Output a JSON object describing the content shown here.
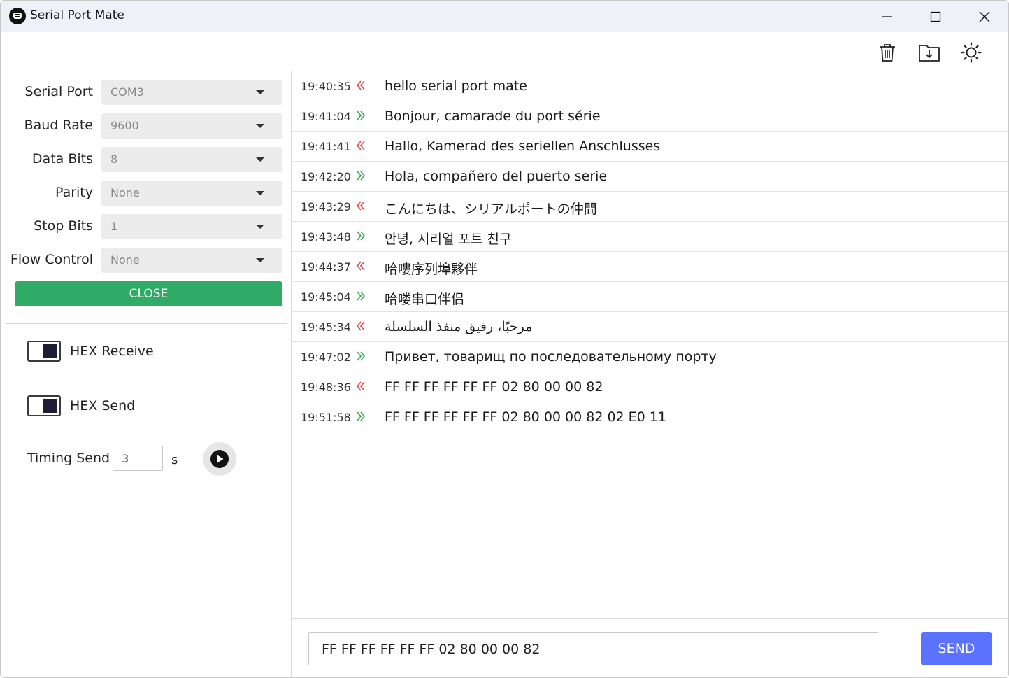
{
  "window": {
    "title": "Serial Port Mate",
    "icon": "chat-bubble-icon",
    "controls": [
      "minimize-icon",
      "maximize-icon",
      "close-icon"
    ]
  },
  "toolbar": {
    "icons": [
      "trash-icon",
      "download-folder-icon",
      "sun-theme-icon"
    ]
  },
  "config": {
    "serial_port": {
      "label": "Serial Port",
      "value": "COM3"
    },
    "baud_rate": {
      "label": "Baud Rate",
      "value": "9600"
    },
    "data_bits": {
      "label": "Data Bits",
      "value": "8"
    },
    "parity": {
      "label": "Parity",
      "value": "None"
    },
    "stop_bits": {
      "label": "Stop Bits",
      "value": "1"
    },
    "flow_control": {
      "label": "Flow Control",
      "value": "None"
    },
    "close_label": "CLOSE"
  },
  "options": {
    "hex_receive": {
      "label": "HEX Receive",
      "checked": true
    },
    "hex_send": {
      "label": "HEX Send",
      "checked": true
    },
    "timing_send": {
      "label": "Timing Send",
      "value": "3",
      "unit": "s"
    }
  },
  "log": [
    {
      "time": "19:40:35",
      "direction": "received",
      "text": "hello serial port mate"
    },
    {
      "time": "19:41:04",
      "direction": "sent",
      "text": "Bonjour, camarade du port série"
    },
    {
      "time": "19:41:41",
      "direction": "received",
      "text": "Hallo, Kamerad des seriellen Anschlusses"
    },
    {
      "time": "19:42:20",
      "direction": "sent",
      "text": "Hola, compañero del puerto serie"
    },
    {
      "time": "19:43:29",
      "direction": "received",
      "text": "こんにちは、シリアルポートの仲間"
    },
    {
      "time": "19:43:48",
      "direction": "sent",
      "text": "안녕, 시리얼 포트 친구"
    },
    {
      "time": "19:44:37",
      "direction": "received",
      "text": "哈嘍序列埠夥伴"
    },
    {
      "time": "19:45:04",
      "direction": "sent",
      "text": "哈喽串口伴侣"
    },
    {
      "time": "19:45:34",
      "direction": "received",
      "text": "مرحبًا، رفيق منفذ السلسلة"
    },
    {
      "time": "19:47:02",
      "direction": "sent",
      "text": "Привет, товарищ по последовательному порту"
    },
    {
      "time": "19:48:36",
      "direction": "received",
      "text": "FF FF FF FF FF FF 02 80 00 00 82"
    },
    {
      "time": "19:51:58",
      "direction": "sent",
      "text": "FF FF FF FF FF FF 02 80 00 00 82 02 E0 11"
    }
  ],
  "colors": {
    "received": "#e0454a",
    "sent": "#3aa655",
    "close_button": "#2faa67",
    "send_button": "#5b72ff"
  },
  "send": {
    "input_value": "FF FF FF FF FF FF 02 80 00 00 82",
    "button_label": "SEND"
  }
}
